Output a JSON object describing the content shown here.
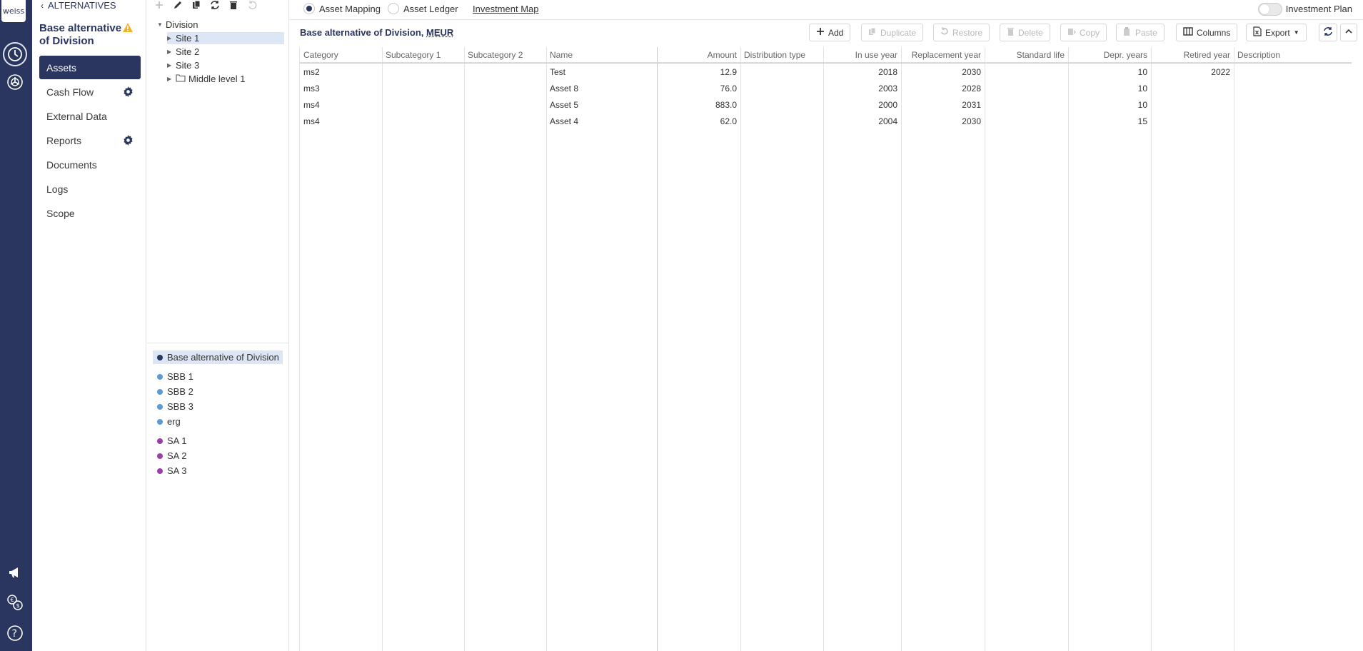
{
  "rail": {
    "logo_text": "weiss",
    "icons": [
      "clock-icon",
      "chart-pie-icon",
      "megaphone-icon",
      "currency-exchange-icon",
      "help-icon"
    ]
  },
  "nav": {
    "back_label": "ALTERNATIVES",
    "alt_title": "Base alternative of Division",
    "items": [
      {
        "label": "Assets",
        "active": true,
        "gear": false
      },
      {
        "label": "Cash Flow",
        "active": false,
        "gear": true
      },
      {
        "label": "External Data",
        "active": false,
        "gear": false
      },
      {
        "label": "Reports",
        "active": false,
        "gear": true
      },
      {
        "label": "Documents",
        "active": false,
        "gear": false
      },
      {
        "label": "Logs",
        "active": false,
        "gear": false
      },
      {
        "label": "Scope",
        "active": false,
        "gear": false
      }
    ]
  },
  "tree": {
    "nodes": [
      {
        "label": "Division",
        "level": 0,
        "expanded": true
      },
      {
        "label": "Site 1",
        "level": 1,
        "selected": true
      },
      {
        "label": "Site 2",
        "level": 1
      },
      {
        "label": "Site 3",
        "level": 1
      },
      {
        "label": "Middle level 1",
        "level": 1,
        "folder": true
      }
    ],
    "alternatives": [
      {
        "label": "Base alternative of Division",
        "color": "#2a3560",
        "selected": true
      },
      {
        "label": "SBB 1",
        "color": "#5a9bd5"
      },
      {
        "label": "SBB 2",
        "color": "#5a9bd5"
      },
      {
        "label": "SBB 3",
        "color": "#5a9bd5"
      },
      {
        "label": "erg",
        "color": "#5a9bd5"
      },
      {
        "label": "SA 1",
        "color": "#9b3fa8"
      },
      {
        "label": "SA 2",
        "color": "#9b3fa8"
      },
      {
        "label": "SA 3",
        "color": "#9b3fa8"
      }
    ]
  },
  "topbar": {
    "asset_mapping": "Asset Mapping",
    "asset_ledger": "Asset Ledger",
    "investment_map": "Investment Map",
    "investment_plan": "Investment Plan"
  },
  "grid": {
    "title": "Base alternative of Division, ",
    "unit": "MEUR",
    "buttons": {
      "add": "Add",
      "duplicate": "Duplicate",
      "restore": "Restore",
      "delete": "Delete",
      "copy": "Copy",
      "paste": "Paste",
      "columns": "Columns",
      "export": "Export"
    },
    "columns": [
      "Category",
      "Subcategory 1",
      "Subcategory 2",
      "Name",
      "Amount",
      "Distribution type",
      "In use year",
      "Replacement year",
      "Standard life",
      "Depr. years",
      "Retired year",
      "Description"
    ],
    "rows": [
      [
        "ms2",
        "",
        "",
        "Test",
        "12.9",
        "",
        "2018",
        "2030",
        "",
        "10",
        "2022",
        ""
      ],
      [
        "ms3",
        "",
        "",
        "Asset 8",
        "76.0",
        "",
        "2003",
        "2028",
        "",
        "10",
        "",
        ""
      ],
      [
        "ms4",
        "",
        "",
        "Asset 5",
        "883.0",
        "",
        "2000",
        "2031",
        "",
        "10",
        "",
        ""
      ],
      [
        "ms4",
        "",
        "",
        "Asset 4",
        "62.0",
        "",
        "2004",
        "2030",
        "",
        "15",
        "",
        ""
      ]
    ]
  }
}
